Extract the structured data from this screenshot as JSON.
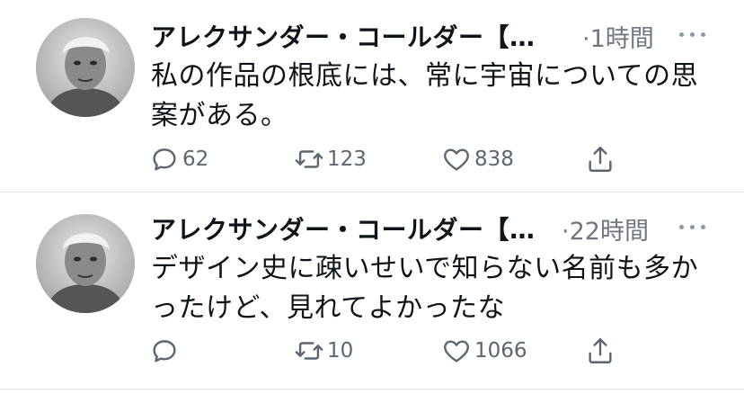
{
  "tweets": [
    {
      "author": "アレクサンダー・コールダー【…",
      "time": "·1時間",
      "text": "私の作品の根底には、常に宇宙についての思案がある。",
      "replies": "62",
      "retweets": "123",
      "likes": "838"
    },
    {
      "author": "アレクサンダー・コールダー【…",
      "time": "·22時間",
      "text": "デザイン史に疎いせいで知らない名前も多かったけど、見れてよかったな",
      "replies": "",
      "retweets": "10",
      "likes": "1066"
    }
  ],
  "icons": {
    "reply": "reply-icon",
    "retweet": "retweet-icon",
    "like": "heart-icon",
    "share": "share-icon",
    "more": "more-dots-icon"
  }
}
